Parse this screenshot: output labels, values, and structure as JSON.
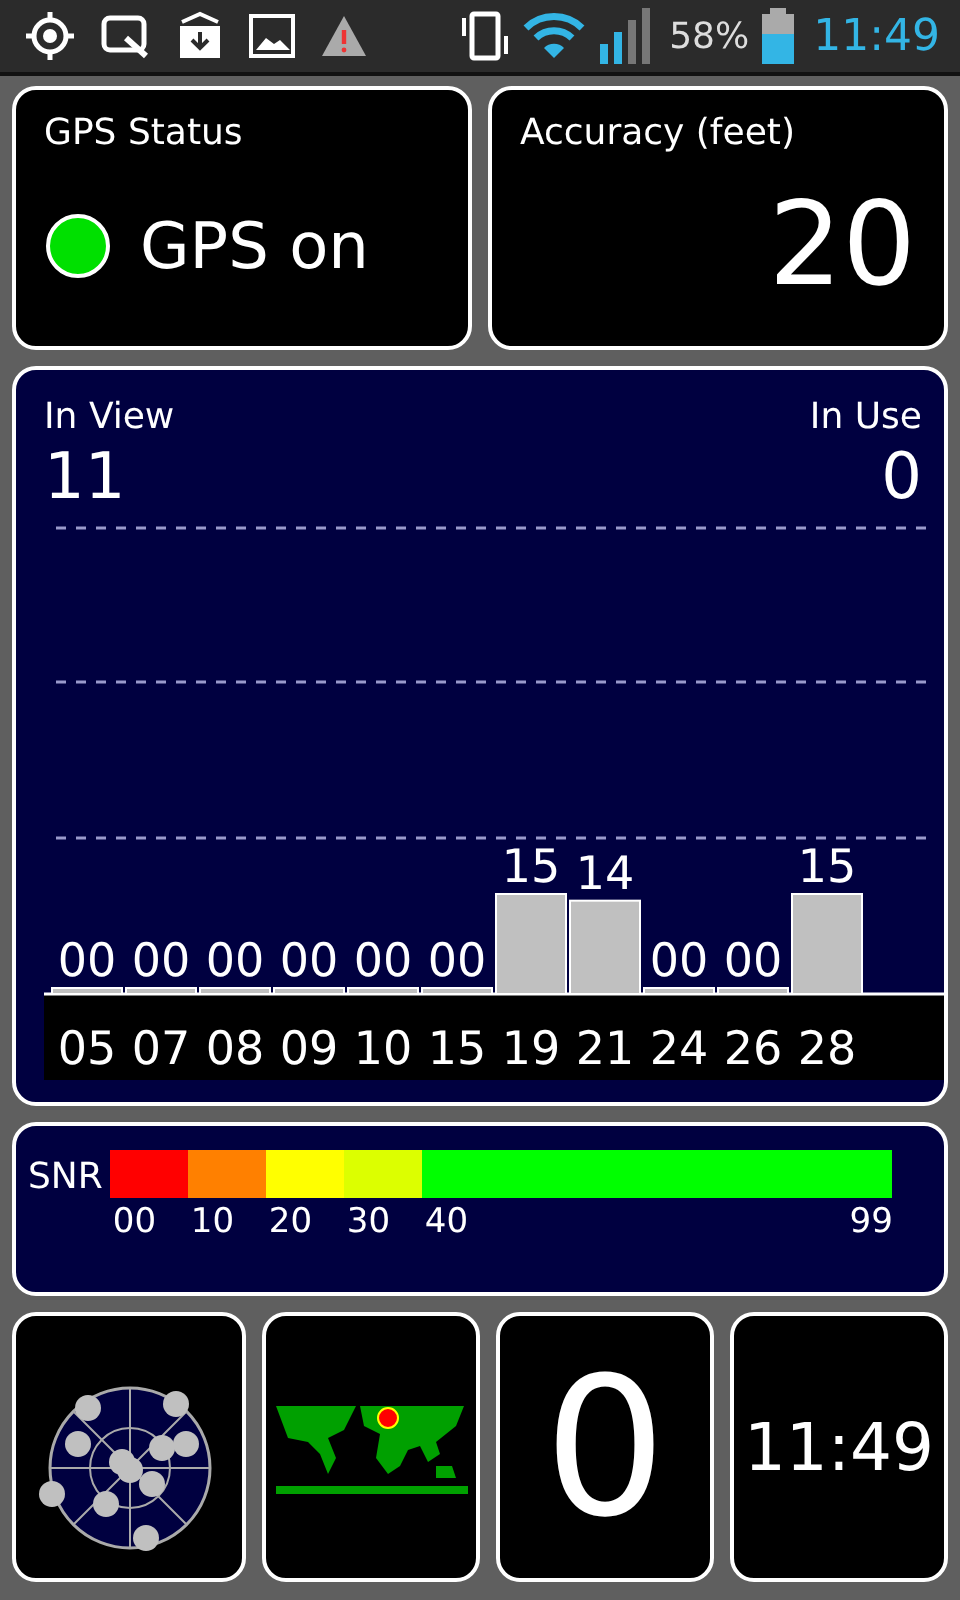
{
  "status_bar": {
    "clock": "11:49",
    "battery_percent": "58%"
  },
  "gps_status": {
    "title": "GPS Status",
    "on": true,
    "label": "GPS on"
  },
  "accuracy": {
    "title": "Accuracy (feet)",
    "value": "20"
  },
  "satellites": {
    "in_view_label": "In View",
    "in_view": "11",
    "in_use_label": "In Use",
    "in_use": "0",
    "chart_data": {
      "type": "bar",
      "categories": [
        "05",
        "07",
        "08",
        "09",
        "10",
        "15",
        "19",
        "21",
        "24",
        "26",
        "28"
      ],
      "values": [
        0,
        0,
        0,
        0,
        0,
        0,
        15,
        14,
        0,
        0,
        15
      ],
      "value_labels": [
        "00",
        "00",
        "00",
        "00",
        "00",
        "00",
        "15",
        "14",
        "00",
        "00",
        "15"
      ]
    }
  },
  "snr": {
    "label": "SNR",
    "segments": [
      {
        "from": "00",
        "color": "#ff0000"
      },
      {
        "from": "10",
        "color": "#ff8000"
      },
      {
        "from": "20",
        "color": "#ffff00"
      },
      {
        "from": "30",
        "color": "#dcff00"
      },
      {
        "from": "40",
        "color": "#00ff00"
      }
    ],
    "max": "99"
  },
  "tiles": [
    {
      "kind": "sky"
    },
    {
      "kind": "map"
    },
    {
      "kind": "number",
      "text": "0"
    },
    {
      "kind": "clock",
      "text": "11:49"
    }
  ]
}
